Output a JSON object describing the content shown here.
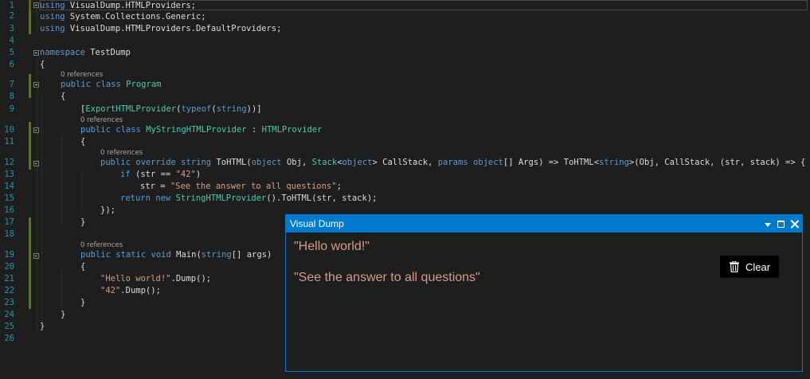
{
  "editor": {
    "line_numbers": [
      "1",
      "2",
      "3",
      "4",
      "5",
      "6",
      "7",
      "8",
      "9",
      "10",
      "11",
      "12",
      "13",
      "14",
      "15",
      "16",
      "17",
      "18",
      "19",
      "20",
      "21",
      "22",
      "23",
      "24",
      "25",
      "26"
    ],
    "refs_label": "0 references",
    "lines": {
      "l1": [
        [
          "kw",
          "using"
        ],
        [
          "",
          "VisualDump.HTMLProviders;"
        ]
      ],
      "l2": [
        [
          "kw",
          "using"
        ],
        [
          "",
          "System.Collections.Generic;"
        ]
      ],
      "l3": [
        [
          "kw",
          "using"
        ],
        [
          "",
          "VisualDump.HTMLProviders.DefaultProviders;"
        ]
      ],
      "l5": [
        [
          "kw",
          "namespace"
        ],
        [
          "",
          "TestDump"
        ]
      ],
      "l6": "{",
      "l7": [
        [
          "kw",
          "public"
        ],
        [
          "kw",
          "class"
        ],
        [
          "ty",
          "Program"
        ]
      ],
      "l8": "{",
      "l9": "[ExportHTMLProvider(typeof(string))]",
      "l10": [
        [
          "kw",
          "public"
        ],
        [
          "kw",
          "class"
        ],
        [
          "ty",
          "MyStringHTMLProvider"
        ],
        [
          "",
          ":"
        ],
        [
          "ty",
          "HTMLProvider"
        ]
      ],
      "l11": "{",
      "l12": "public override string ToHTML(object Obj, Stack<object> CallStack, params object[] Args) => ToHTML<string>(Obj, CallStack, (str, stack) => {",
      "l13": "if (str == \"42\")",
      "l14": "str = \"See the answer to all questions\";",
      "l15": "return new StringHTMLProvider().ToHTML(str, stack);",
      "l16": "});",
      "l17": "}",
      "l19": "public static void Main(string[] args)",
      "l20": "{",
      "l21": "\"Hello world!\".Dump();",
      "l22": "\"42\".Dump();",
      "l23": "}",
      "l24": "}",
      "l25": "}"
    }
  },
  "visual_dump": {
    "title": "Visual Dump",
    "outputs": [
      "\"Hello world!\"",
      "\"See the answer to all questions\""
    ],
    "clear_label": "Clear",
    "accent": "#007acc",
    "output_color": "#d69d85"
  },
  "colors": {
    "keyword": "#569cd6",
    "type": "#4ec9b0",
    "string": "#d69d85",
    "line_number": "#2b91af"
  }
}
